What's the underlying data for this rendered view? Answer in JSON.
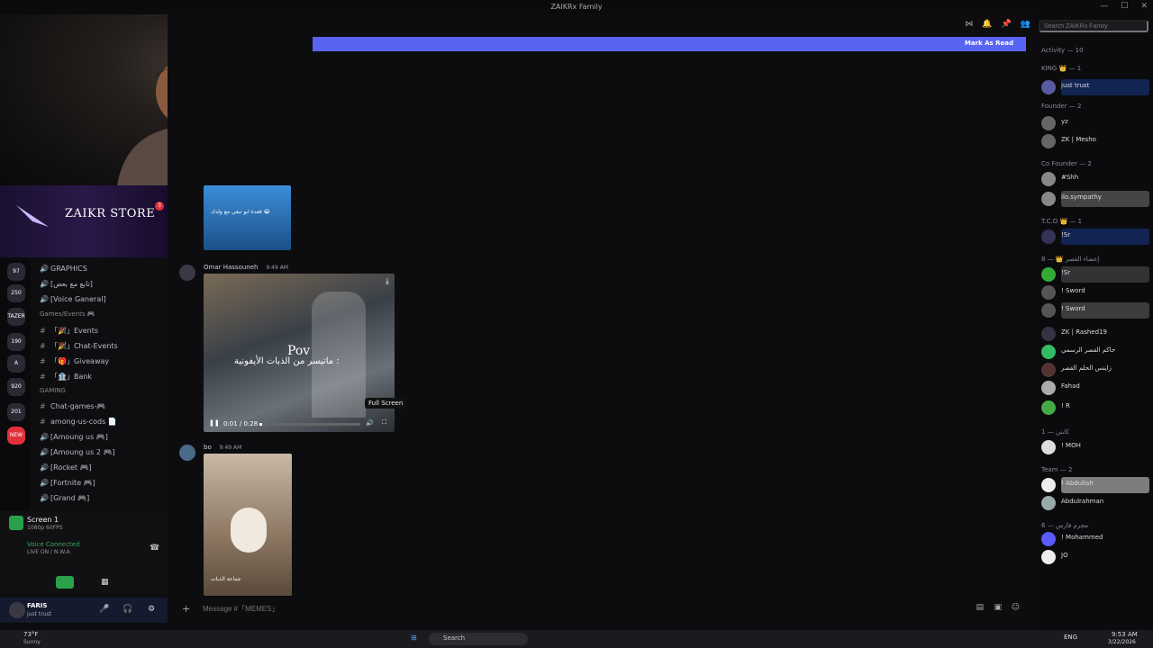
{
  "window": {
    "title": "ZAIKRx Family"
  },
  "store": {
    "title": "ZAIKR STORE",
    "badge": "3"
  },
  "guilds": [
    "97",
    "250",
    "TAZER",
    "190",
    "A",
    "920",
    "201",
    "NEW"
  ],
  "channels": [
    {
      "type": "voice",
      "label": "GRAPHICS",
      "prefix": "🎨"
    },
    {
      "type": "voice",
      "label": "[تابع مع بعض]",
      "suffix": "📺"
    },
    {
      "type": "voice",
      "label": "[Voice Ganeral]",
      "suffix": "📝"
    },
    {
      "type": "category",
      "label": "Games/Events 🎮"
    },
    {
      "type": "text",
      "label": "「🎉」Events"
    },
    {
      "type": "text",
      "label": "「🎉」Chat-Events"
    },
    {
      "type": "text",
      "label": "「🎁」Giveaway"
    },
    {
      "type": "text",
      "label": "「🏦」Bank"
    },
    {
      "type": "category",
      "label": "GAMING"
    },
    {
      "type": "text",
      "label": "Chat-games-🎮"
    },
    {
      "type": "text",
      "label": "among-us-cods 📄"
    },
    {
      "type": "voice",
      "label": "[Amoung us 🎮]"
    },
    {
      "type": "voice",
      "label": "[Amoung us 2 🎮]"
    },
    {
      "type": "voice",
      "label": "[Rocket 🎮]"
    },
    {
      "type": "voice",
      "label": "[Fortnite 🎮]"
    },
    {
      "type": "voice",
      "label": "[Grand 🎮]"
    }
  ],
  "screen": {
    "title": "Screen 1",
    "sub": "1080p 60FPS"
  },
  "voice": {
    "status": "Voice Connected",
    "channel": "LIVE ON / N.W.A"
  },
  "user": {
    "name": "FARIS",
    "status": "just trust"
  },
  "banner": {
    "mark_read": "Mark As Read"
  },
  "messages": [
    {
      "author": "Omar Hassouneh",
      "time": "9:49 AM",
      "caption_en": "Pov",
      "caption_ar": "ماتيسر من الذبات الأيفونية :",
      "player_time": "0:01 / 0:28",
      "tooltip": "Full Screen"
    },
    {
      "author": "bo",
      "time": "9:49 AM",
      "caption_ar": "جماعة الذبات"
    }
  ],
  "first_video_caption": "قعدة ابو تبعي مع ولدك 😂",
  "compose": {
    "placeholder": "Message #「MEMES」"
  },
  "members_search": {
    "placeholder": "Search ZAIKRx Family"
  },
  "member_groups": [
    {
      "header": "Activity — 10"
    },
    {
      "header": "KING 👑 — 1"
    },
    {
      "header": "Founder — 2"
    },
    {
      "header": "Co Founder — 2"
    },
    {
      "header": "T.C.O 👑 — 1"
    },
    {
      "header": "إعضاء القصر 👑 — 8"
    },
    {
      "header": "كابتن — 1"
    },
    {
      "header": "Team — 2"
    },
    {
      "header": "مجرم فارس — 6"
    }
  ],
  "members": [
    "just trust",
    "yz",
    "ZK | Mesho",
    "#Shh",
    "ilo.sympathy",
    "!Sr",
    "!Sr",
    "! Sword",
    "! Sword",
    "ZK | Rashed19",
    "حاكم القصر الرسمي",
    "زايتس الحلم القصر",
    "Fahad",
    "! R",
    "! MOH",
    "! Abdullah",
    "Abdulrahman",
    "! Mohammed",
    "JO"
  ],
  "taskbar": {
    "weather": "73°F",
    "weather_sub": "Sunny",
    "search": "Search",
    "lang": "ENG",
    "time": "9:53 AM",
    "date": "3/22/2026"
  }
}
